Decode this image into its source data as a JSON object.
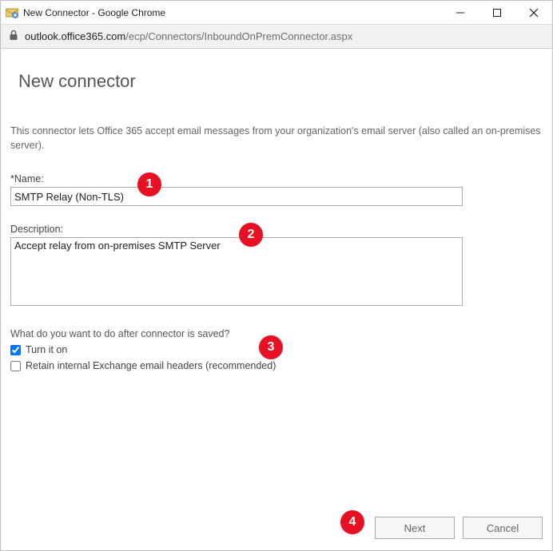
{
  "window": {
    "title": "New Connector - Google Chrome"
  },
  "urlbar": {
    "host": "outlook.office365.com",
    "path": "/ecp/Connectors/InboundOnPremConnector.aspx"
  },
  "page": {
    "heading": "New connector",
    "intro": "This connector lets Office 365 accept email messages from your organization's email server (also called an on-premises server).",
    "name_label": "*Name:",
    "name_value": "SMTP Relay (Non-TLS)",
    "description_label": "Description:",
    "description_value_pre": "Accept relay from on-premises ",
    "description_value_spell": "SMTP",
    "description_value_post": " Server",
    "after_save_question": "What do you want to do after connector is saved?",
    "checkbox_turn_on": "Turn it on",
    "checkbox_retain": "Retain internal Exchange email headers (recommended)"
  },
  "footer": {
    "next": "Next",
    "cancel": "Cancel"
  },
  "badges": {
    "b1": "1",
    "b2": "2",
    "b3": "3",
    "b4": "4"
  }
}
